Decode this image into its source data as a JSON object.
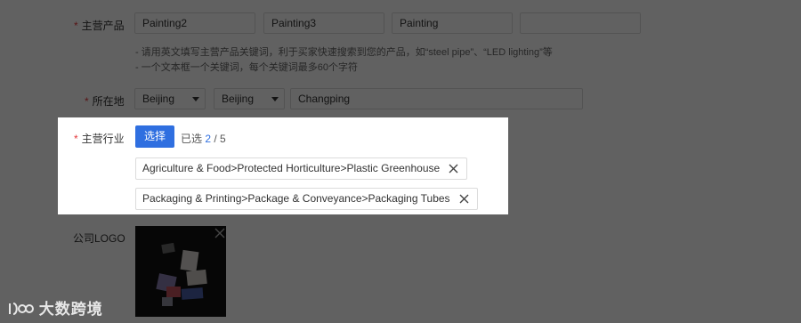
{
  "products": {
    "label": "主营产品",
    "fields": [
      "Painting2",
      "Painting3",
      "Painting",
      ""
    ],
    "hints": [
      "- 请用英文填写主营产品关键词，利于买家快速搜索到您的产品，如“steel pipe”、“LED lighting”等",
      "- 一个文本框一个关键词，每个关键词最多60个字符"
    ]
  },
  "location": {
    "label": "所在地",
    "province": "Beijing",
    "city": "Beijing",
    "district": "Changping"
  },
  "industry": {
    "label": "主营行业",
    "select_button": "选择",
    "selected_prefix": "已选",
    "selected_count": "2",
    "selected_total": "/ 5",
    "tags": [
      "Agriculture & Food>Protected Horticulture>Plastic Greenhouse",
      "Packaging & Printing>Package & Conveyance>Packaging Tubes"
    ]
  },
  "logo": {
    "label": "公司LOGO"
  },
  "watermark": "大数跨境",
  "colors": {
    "primary": "#2f6fe0",
    "required": "#e4393c",
    "count": "#2f6fe0"
  }
}
